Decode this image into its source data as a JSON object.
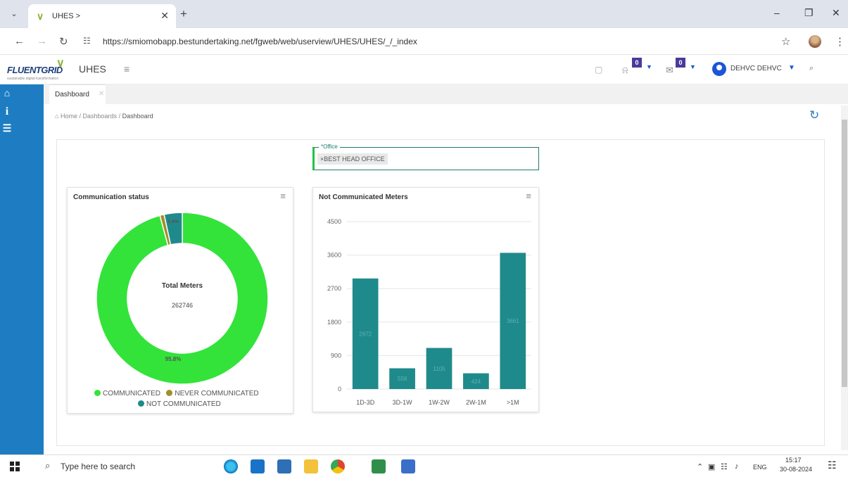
{
  "browser": {
    "tab_title": "UHES >",
    "new_tab": "+",
    "url": "https://smiomobapp.bestundertaking.net/fgweb/web/userview/UHES/UHES/_/_index"
  },
  "app": {
    "logo_text": "FLUENTGRID",
    "logo_tagline": "sustainable digital transformation",
    "title": "UHES",
    "notifications_count": "0",
    "messages_count": "0",
    "user_name": "DEHVC DEHVC"
  },
  "tabs": [
    {
      "label": "Dashboard"
    }
  ],
  "breadcrumb": {
    "home": "Home",
    "sep": "/",
    "dashboards": "Dashboards",
    "current": "Dashboard"
  },
  "office_filter": {
    "label": "*Office",
    "value": "BEST HEAD OFFICE"
  },
  "communication_status": {
    "title": "Communication status",
    "center_title": "Total Meters",
    "center_value": "262746",
    "labels": {
      "communicated": "95.8%",
      "not_communicated": "3.4%"
    },
    "legend": [
      "COMMUNICATED",
      "NEVER COMMUNICATED",
      "NOT COMMUNICATED"
    ]
  },
  "not_communicated": {
    "title": "Not Communicated Meters"
  },
  "chart_data": [
    {
      "type": "pie",
      "title": "Communication status",
      "labels": [
        "COMMUNICATED",
        "NEVER COMMUNICATED",
        "NOT COMMUNICATED"
      ],
      "values": [
        95.8,
        0.8,
        3.4
      ],
      "colors": [
        "#33e33a",
        "#a28e2a",
        "#1f8a8c"
      ],
      "legend": "bottom"
    },
    {
      "type": "bar",
      "title": "Not Communicated Meters",
      "categories": [
        "1D-3D",
        "3D-1W",
        "1W-2W",
        "2W-1M",
        ">1M"
      ],
      "values": [
        2972,
        558,
        1105,
        424,
        3661
      ],
      "ylim": [
        0,
        4500
      ],
      "yticks": [
        0,
        900,
        1800,
        2700,
        3600,
        4500
      ],
      "color": "#1f8a8c",
      "grid": true
    }
  ],
  "taskbar": {
    "search_placeholder": "Type here to search",
    "lang": "ENG",
    "time": "15:17",
    "date": "30-08-2024"
  },
  "colors": {
    "sidebar": "#1e7dc2",
    "accent": "#1f7a6d",
    "communicated": "#33e33a",
    "never_communicated": "#a28e2a",
    "not_communicated": "#1f8a8c"
  }
}
